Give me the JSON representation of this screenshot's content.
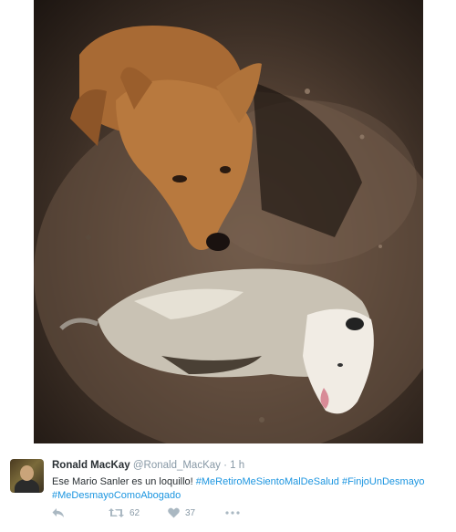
{
  "media": {
    "photo_icon": "photo-opossum-dog"
  },
  "tweet": {
    "author_name": "Ronald MacKay",
    "handle": "@Ronald_MacKay",
    "separator": "·",
    "time": "1 h",
    "text_plain": "Ese Mario Sanler es un loquillo! ",
    "hashtags": [
      "#MeRetiroMeSientoMalDeSalud",
      "#FinjoUnDesmayo",
      "#MeDesmayoComoAbogado"
    ],
    "retweet_count": "62",
    "like_count": "37"
  },
  "colors": {
    "text": "#292f33",
    "secondary": "#8899a6",
    "link": "#1b95e0",
    "icon": "#aab8c2"
  }
}
